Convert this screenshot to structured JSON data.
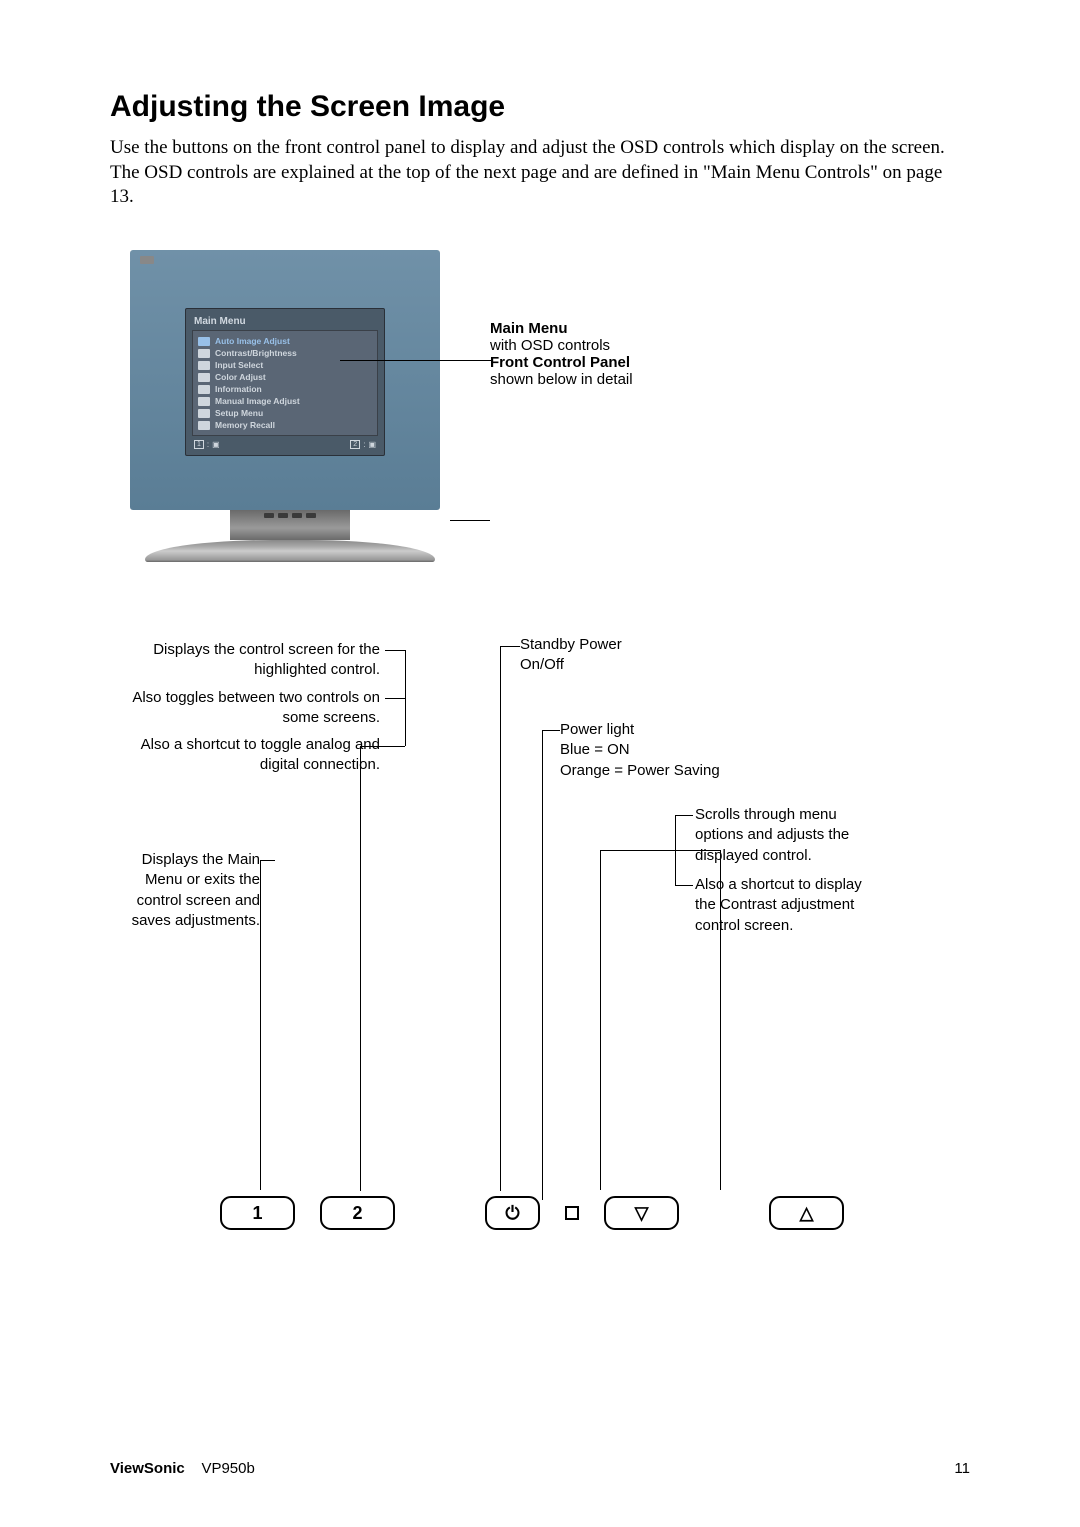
{
  "heading": "Adjusting the Screen Image",
  "intro": "Use the buttons on the front control panel to display and adjust the OSD controls which display on the screen. The OSD controls are explained at the top of the next page and are defined in \"Main Menu Controls\" on page 13.",
  "osd": {
    "title": "Main Menu",
    "items": [
      "Auto Image Adjust",
      "Contrast/Brightness",
      "Input Select",
      "Color Adjust",
      "Information",
      "Manual Image Adjust",
      "Setup Menu",
      "Memory Recall"
    ],
    "footer_left_num": "1",
    "footer_right_num": "2",
    "footer_sym": ":"
  },
  "monitor_labels": {
    "main_menu_title": "Main Menu",
    "main_menu_sub": "with OSD controls",
    "panel_title": "Front Control Panel",
    "panel_sub": "shown below in detail"
  },
  "callouts": {
    "control_screen": "Displays the control screen for the highlighted control.",
    "toggle": "Also toggles between two controls on some screens.",
    "shortcut_analog": "Also a shortcut to toggle analog and digital connection.",
    "main_menu": "Displays the Main Menu or exits the control screen and saves adjustments.",
    "standby": "Standby Power On/Off",
    "standby_l1": "Standby Power",
    "standby_l2": "On/Off",
    "power_light_l1": "Power light",
    "power_light_l2": "Blue = ON",
    "power_light_l3": "Orange = Power Saving",
    "scroll": "Scrolls through menu options and adjusts the displayed control.",
    "shortcut_contrast": "Also a shortcut to display the Contrast adjustment control screen."
  },
  "buttons": {
    "b1": "1",
    "b2": "2",
    "power": "⏻",
    "down": "▽",
    "up": "△"
  },
  "footer": {
    "brand": "ViewSonic",
    "model": "VP950b",
    "page": "11"
  }
}
